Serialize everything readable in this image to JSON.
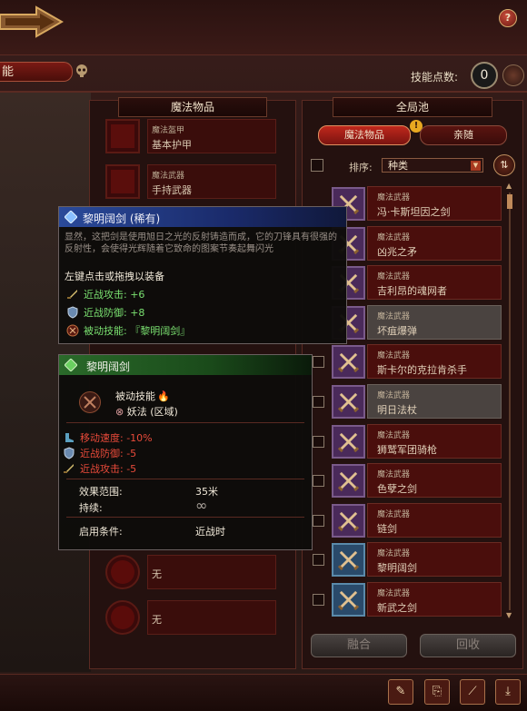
{
  "top": {
    "tab_label": "能",
    "help_label": "?",
    "skill_points_label": "技能点数:",
    "skill_points_value": "0"
  },
  "left_panel": {
    "title": "魔法物品",
    "slots": [
      {
        "category": "魔法盔甲",
        "name": "基本护甲"
      },
      {
        "category": "魔法武器",
        "name": "手持武器"
      }
    ],
    "round_slots": [
      {
        "name": "无"
      },
      {
        "name": "无"
      }
    ]
  },
  "right_panel": {
    "title": "全局池",
    "tab_magic_items": "魔法物品",
    "tab_retinue": "亲随",
    "alert": "!",
    "sort_label": "排序:",
    "sort_value": "种类",
    "sort_caret": "▼",
    "sort_toggle": "⇅",
    "items": [
      {
        "category": "魔法武器",
        "name": "冯·卡斯坦因之剑",
        "icon": "crossed-swords-icon"
      },
      {
        "category": "魔法武器",
        "name": "凶兆之矛",
        "icon": "crossed-swords-icon"
      },
      {
        "category": "魔法武器",
        "name": "吉利昂的魂网者",
        "icon": "crossed-swords-icon"
      },
      {
        "category": "魔法武器",
        "name": "坏疽爆弹",
        "icon": "crossed-swords-icon"
      },
      {
        "category": "魔法武器",
        "name": "斯卡尔的克拉肯杀手",
        "icon": "crossed-swords-icon"
      },
      {
        "category": "魔法武器",
        "name": "明日法杖",
        "icon": "crossed-swords-icon"
      },
      {
        "category": "魔法武器",
        "name": "狮鹫军团骑枪",
        "icon": "crossed-swords-icon"
      },
      {
        "category": "魔法武器",
        "name": "色孽之剑",
        "icon": "crossed-swords-icon"
      },
      {
        "category": "魔法武器",
        "name": "链剑",
        "icon": "crossed-swords-icon"
      },
      {
        "category": "魔法武器",
        "name": "黎明阔剑",
        "icon": "crossed-swords-icon"
      },
      {
        "category": "魔法武器",
        "name": "新武之剑",
        "icon": "crossed-swords-icon"
      }
    ],
    "fuse_label": "融合",
    "recycle_label": "回收"
  },
  "tooltip_item": {
    "title": "黎明阔剑 (稀有)",
    "description": "显然，这把剑是使用旭日之光的反射铸造而成，它的刀锋具有很强的反射性，会使得光辉随着它致命的图案节奏起舞闪光",
    "hint": "左键点击或拖拽以装备",
    "stats": [
      {
        "text": "近战攻击: +6",
        "icon": "sword-icon"
      },
      {
        "text": "近战防御: +8",
        "icon": "shield-icon"
      },
      {
        "text": "被动技能: 『黎明阔剑』",
        "icon": "skill-icon"
      }
    ]
  },
  "tooltip_skill": {
    "title": "黎明阔剑",
    "passive_label": "被动技能",
    "flame": "🔥",
    "school": "妖法 (区域)",
    "effects": [
      {
        "text": "移动速度: -10%",
        "icon": "boot-icon"
      },
      {
        "text": "近战防御: -5",
        "icon": "shield-icon"
      },
      {
        "text": "近战攻击: -5",
        "icon": "sword-icon"
      }
    ],
    "range_label": "效果范围:",
    "range_value": "35米",
    "duration_label": "持续:",
    "duration_value": "∞",
    "condition_label": "启用条件:",
    "condition_value": "近战时"
  },
  "footer": {
    "buttons": [
      "✎",
      "⎘",
      "⟋",
      "⤓"
    ]
  },
  "colors": {
    "accent_red": "#c0281c",
    "positive_green": "#7ae070",
    "negative_red": "#e84a3a",
    "rare_blue": "#2a4a9a"
  }
}
